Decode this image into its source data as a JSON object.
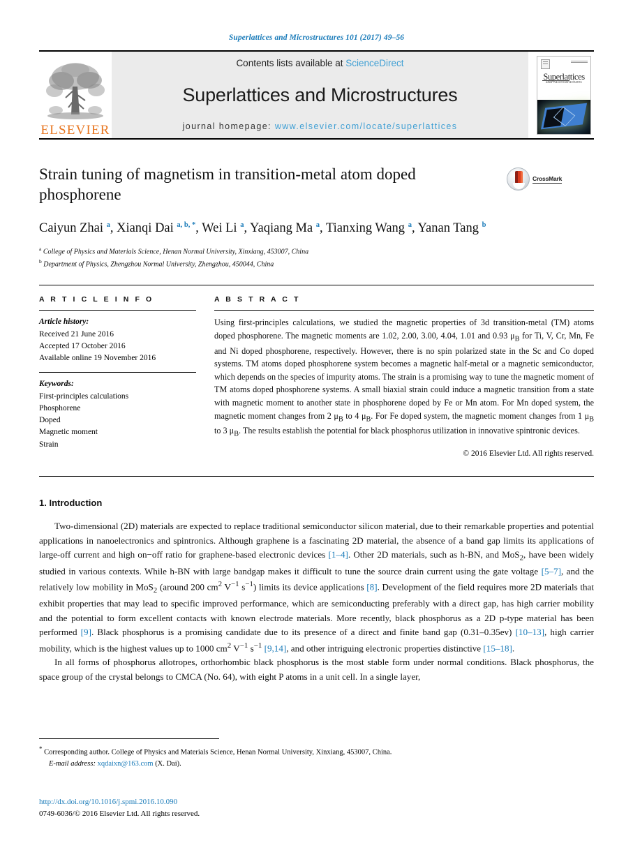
{
  "running_head": "Superlattices and Microstructures 101 (2017) 49–56",
  "masthead": {
    "publisher_word": "ELSEVIER",
    "publisher_logo_name": "elsevier-tree-logo",
    "contents_prefix": "Contents lists available at ",
    "contents_link": "ScienceDirect",
    "journal_title": "Superlattices and Microstructures",
    "homepage_prefix": "journal homepage: ",
    "homepage_url": "www.elsevier.com/locate/superlattices",
    "cover": {
      "name": "Superlattices",
      "subtitle": "and Microstructures"
    }
  },
  "title": "Strain tuning of magnetism in transition-metal atom doped phosphorene",
  "crossmark_label": "CrossMark",
  "authors_line1_parts": [
    {
      "name": "Caiyun Zhai",
      "sup": "a"
    },
    {
      "name": "Xianqi Dai",
      "sup": "a, b, *"
    },
    {
      "name": "Wei Li",
      "sup": "a"
    },
    {
      "name": "Yaqiang Ma",
      "sup": "a"
    },
    {
      "name": "Tianxing Wang",
      "sup": "a"
    },
    {
      "name": "Yanan Tang",
      "sup": "b"
    }
  ],
  "affiliations": [
    {
      "mark": "a",
      "text": "College of Physics and Materials Science, Henan Normal University, Xinxiang, 453007, China"
    },
    {
      "mark": "b",
      "text": "Department of Physics, Zhengzhou Normal University, Zhengzhou, 450044, China"
    }
  ],
  "article_info": {
    "heading": "A R T I C L E   I N F O",
    "history_label": "Article history:",
    "history": [
      "Received 21 June 2016",
      "Accepted 17 October 2016",
      "Available online 19 November 2016"
    ],
    "keywords_label": "Keywords:",
    "keywords": [
      "First-principles calculations",
      "Phosphorene",
      "Doped",
      "Magnetic moment",
      "Strain"
    ]
  },
  "abstract": {
    "heading": "A B S T R A C T",
    "text": "Using first-principles calculations, we studied the magnetic properties of 3d transition-metal (TM) atoms doped phosphorene. The magnetic moments are 1.02, 2.00, 3.00, 4.04, 1.01 and 0.93 μB for Ti, V, Cr, Mn, Fe and Ni doped phosphorene, respectively. However, there is no spin polarized state in the Sc and Co doped systems. TM atoms doped phosphorene system becomes a magnetic half-metal or a magnetic semiconductor, which depends on the species of impurity atoms. The strain is a promising way to tune the magnetic moment of TM atoms doped phosphorene systems. A small biaxial strain could induce a magnetic transition from a state with magnetic moment to another state in phosphorene doped by Fe or Mn atom. For Mn doped system, the magnetic moment changes from 2 μB to 4 μB. For Fe doped system, the magnetic moment changes from 1 μB to 3 μB. The results establish the potential for black phosphorus utilization in innovative spintronic devices.",
    "copyright": "© 2016 Elsevier Ltd. All rights reserved."
  },
  "section": {
    "number_title": "1. Introduction",
    "paragraph1": "Two-dimensional (2D) materials are expected to replace traditional semiconductor silicon material, due to their remarkable properties and potential applications in nanoelectronics and spintronics. Although graphene is a fascinating 2D material, the absence of a band gap limits its applications of large-off current and high on−off ratio for graphene-based electronic devices [1–4]. Other 2D materials, such as h-BN, and MoS2, have been widely studied in various contexts. While h-BN with large bandgap makes it difficult to tune the source drain current using the gate voltage [5–7], and the relatively low mobility in MoS2 (around 200 cm2 V−1 s−1) limits its device applications [8]. Development of the field requires more 2D materials that exhibit properties that may lead to specific improved performance, which are semiconducting preferably with a direct gap, has high carrier mobility and the potential to form excellent contacts with known electrode materials. More recently, black phosphorus as a 2D p-type material has been performed [9]. Black phosphorus is a promising candidate due to its presence of a direct and finite band gap (0.31–0.35ev) [10–13], high carrier mobility, which is the highest values up to 1000 cm2 V−1 s−1 [9,14], and other intriguing electronic properties distinctive [15–18].",
    "paragraph2": "In all forms of phosphorus allotropes, orthorhombic black phosphorus is the most stable form under normal conditions. Black phosphorus, the space group of the crystal belongs to CMCA (No. 64), with eight P atoms in a unit cell. In a single layer,"
  },
  "footnotes": {
    "corresponding": "Corresponding author. College of Physics and Materials Science, Henan Normal University, Xinxiang, 453007, China.",
    "email_label": "E-mail address:",
    "email": "xqdaixn@163.com",
    "email_owner": "(X. Dai)."
  },
  "bottom": {
    "doi": "http://dx.doi.org/10.1016/j.spmi.2016.10.090",
    "issn_line": "0749-6036/© 2016 Elsevier Ltd. All rights reserved."
  },
  "colors": {
    "link": "#1a7bb9",
    "elsevier_orange": "#E87722",
    "masthead_bg": "#ebebeb"
  }
}
